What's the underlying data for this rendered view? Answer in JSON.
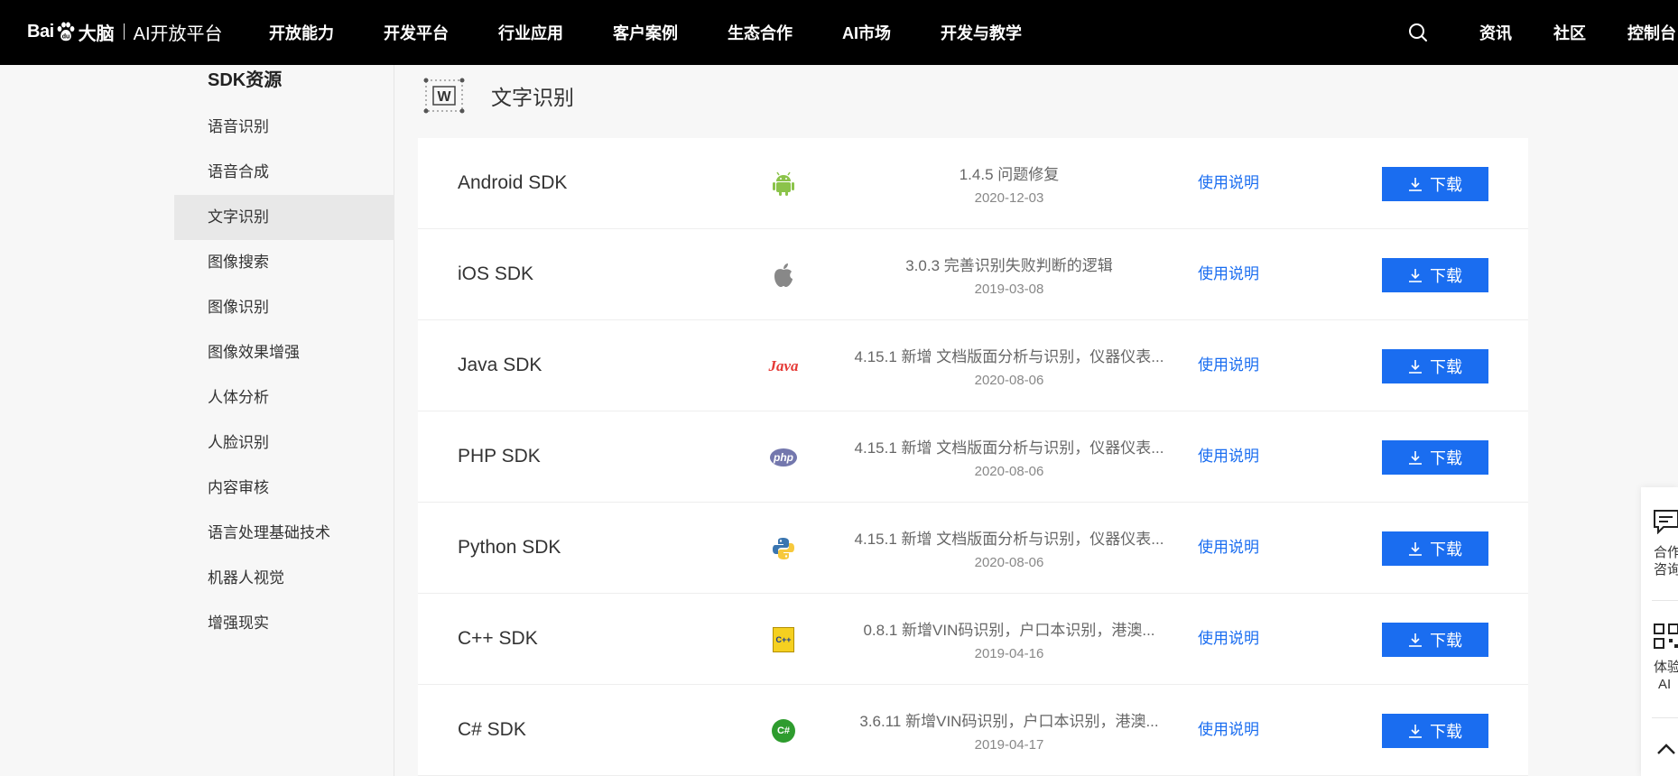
{
  "header": {
    "logo_text": "Bai",
    "logo_brain": "大脑",
    "logo_platform": "AI开放平台",
    "nav": [
      "开放能力",
      "开发平台",
      "行业应用",
      "客户案例",
      "生态合作",
      "AI市场",
      "开发与教学"
    ],
    "right_links": [
      "资讯",
      "社区",
      "控制台"
    ]
  },
  "sidebar": {
    "title": "SDK资源",
    "items": [
      "语音识别",
      "语音合成",
      "文字识别",
      "图像搜索",
      "图像识别",
      "图像效果增强",
      "人体分析",
      "人脸识别",
      "内容审核",
      "语言处理基础技术",
      "机器人视觉",
      "增强现实"
    ],
    "active_index": 2
  },
  "section": {
    "icon_letter": "W",
    "title": "文字识别"
  },
  "sdks": [
    {
      "name": "Android SDK",
      "icon": "android-icon",
      "version": "1.4.5 问题修复",
      "date": "2020-12-03",
      "doc": "使用说明",
      "download": "下载"
    },
    {
      "name": "iOS SDK",
      "icon": "apple-icon",
      "version": "3.0.3 完善识别失败判断的逻辑",
      "date": "2019-03-08",
      "doc": "使用说明",
      "download": "下载"
    },
    {
      "name": "Java SDK",
      "icon": "java-icon",
      "icon_text": "Java",
      "version": "4.15.1 新增 文档版面分析与识别，仪器仪表...",
      "date": "2020-08-06",
      "doc": "使用说明",
      "download": "下载"
    },
    {
      "name": "PHP SDK",
      "icon": "php-icon",
      "icon_text": "php",
      "version": "4.15.1 新增 文档版面分析与识别，仪器仪表...",
      "date": "2020-08-06",
      "doc": "使用说明",
      "download": "下载"
    },
    {
      "name": "Python SDK",
      "icon": "python-icon",
      "version": "4.15.1 新增 文档版面分析与识别，仪器仪表...",
      "date": "2020-08-06",
      "doc": "使用说明",
      "download": "下载"
    },
    {
      "name": "C++ SDK",
      "icon": "cpp-icon",
      "icon_text": "C++",
      "version": "0.8.1 新增VIN码识别，户口本识别，港澳...",
      "date": "2019-04-16",
      "doc": "使用说明",
      "download": "下载"
    },
    {
      "name": "C# SDK",
      "icon": "csharp-icon",
      "icon_text": "C#",
      "version": "3.6.11 新增VIN码识别，户口本识别，港澳...",
      "date": "2019-04-17",
      "doc": "使用说明",
      "download": "下载"
    }
  ],
  "float_tools": {
    "consult_label_1": "合作",
    "consult_label_2": "咨询",
    "experience_label_1": "体验",
    "experience_label_2": "AI"
  },
  "colors": {
    "nav_bg": "#000000",
    "accent": "#1a6df0",
    "active_bg": "#e8e8e8",
    "android": "#8bc34a",
    "java": "#e53935",
    "php": "#7377ad",
    "csharp": "#2e9c2e"
  }
}
